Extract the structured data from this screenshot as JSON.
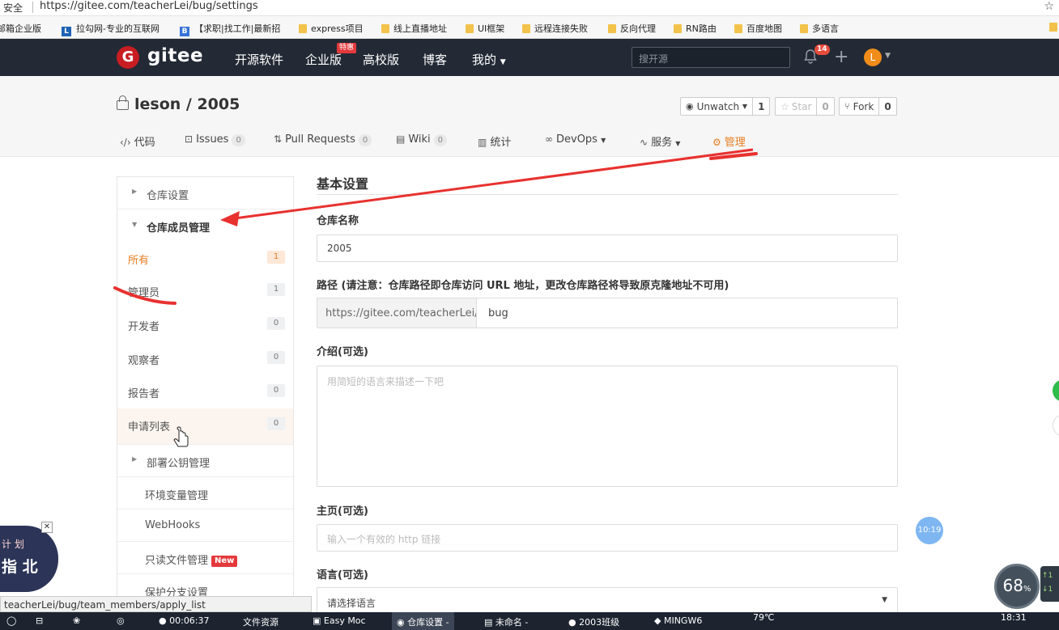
{
  "browser": {
    "security_label": "安全",
    "url": "https://gitee.com/teacherLei/bug/settings",
    "bookmarks": [
      "邮箱企业版",
      "拉勾网-专业的互联网",
      "【求职|找工作|最新招",
      "express项目",
      "线上直播地址",
      "UI框架",
      "远程连接失败",
      "反向代理",
      "RN路由",
      "百度地图",
      "多语言"
    ]
  },
  "header": {
    "logo_text": "gitee",
    "nav": [
      "开源软件",
      "企业版",
      "高校版",
      "博客",
      "我的"
    ],
    "promo_tag": "特惠",
    "search_placeholder": "搜开源",
    "notification_count": "14",
    "avatar_initial": "L"
  },
  "repo": {
    "title": "leson / 2005",
    "watch_label": "Unwatch",
    "watch_count": "1",
    "star_label": "Star",
    "star_count": "0",
    "fork_label": "Fork",
    "fork_count": "0",
    "tabs": [
      {
        "label": "代码",
        "count": ""
      },
      {
        "label": "Issues",
        "count": "0"
      },
      {
        "label": "Pull Requests",
        "count": "0"
      },
      {
        "label": "Wiki",
        "count": "0"
      },
      {
        "label": "统计",
        "count": ""
      },
      {
        "label": "DevOps",
        "count": ""
      },
      {
        "label": "服务",
        "count": ""
      },
      {
        "label": "管理",
        "count": ""
      }
    ]
  },
  "sidebar": {
    "repo_settings": "仓库设置",
    "member_mgmt": "仓库成员管理",
    "members": [
      {
        "label": "所有",
        "count": "1"
      },
      {
        "label": "管理员",
        "count": "1"
      },
      {
        "label": "开发者",
        "count": "0"
      },
      {
        "label": "观察者",
        "count": "0"
      },
      {
        "label": "报告者",
        "count": "0"
      },
      {
        "label": "申请列表",
        "count": "0"
      }
    ],
    "deploy_keys": "部署公钥管理",
    "env_vars": "环境变量管理",
    "webhooks": "WebHooks",
    "readonly_files": "只读文件管理",
    "new_tag": "New",
    "branch_settings": "保护分支设置"
  },
  "form": {
    "title": "基本设置",
    "name_label": "仓库名称",
    "name_value": "2005",
    "path_label": "路径 (请注意：仓库路径即仓库访问 URL 地址，更改仓库路径将导致原克隆地址不可用)",
    "path_prefix": "https://gitee.com/teacherLei/",
    "path_value": "bug",
    "desc_label": "介绍(可选)",
    "desc_placeholder": "用简短的语言来描述一下吧",
    "homepage_label": "主页(可选)",
    "homepage_placeholder": "输入一个有效的 http 链接",
    "lang_label": "语言(可选)",
    "lang_value": "请选择语言"
  },
  "overlay": {
    "status_url": "teacherLei/bug/team_members/apply_list",
    "timer": "10:19",
    "gauge_value": "68",
    "gauge_unit": "%",
    "left_badge_line1": "计 划",
    "left_badge_line2": "指 北"
  },
  "taskbar": {
    "items": [
      "文件资源",
      "Easy Moc",
      "仓库设置 -",
      "未命名 -",
      "2003班级",
      "MINGW6"
    ],
    "clock_time": "00:06:37",
    "temperature": "79℃",
    "time": "18:31"
  },
  "colors": {
    "accent": "#e67e22",
    "header_bg": "#232a35",
    "logo_red": "#c71d23",
    "annotation": "#e8312f"
  }
}
